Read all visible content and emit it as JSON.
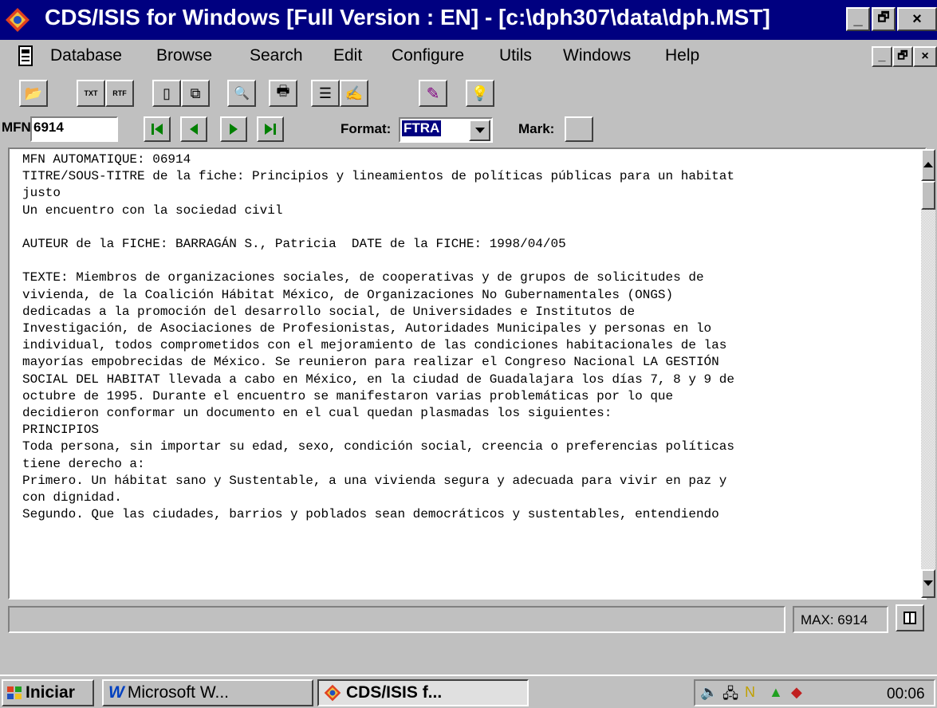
{
  "window": {
    "title": "CDS/ISIS for Windows [Full Version : EN] - [c:\\dph307\\data\\dph.MST]",
    "controls": [
      "_",
      "🗗",
      "×"
    ]
  },
  "menu": {
    "items": [
      {
        "label": "Database"
      },
      {
        "label": "Browse"
      },
      {
        "label": "Search"
      },
      {
        "label": "Edit"
      },
      {
        "label": "Configure"
      },
      {
        "label": "Utils"
      },
      {
        "label": "Windows"
      },
      {
        "label": "Help"
      }
    ],
    "controls": [
      "_",
      "🗗",
      "×"
    ]
  },
  "toolbar": {
    "buttons": [
      {
        "icon": "open-folder-icon",
        "glyph": "📂"
      },
      {
        "icon": "export-txt-icon",
        "glyph": "TXT"
      },
      {
        "icon": "export-rtf-icon",
        "glyph": "RTF"
      },
      {
        "icon": "new-record-icon",
        "glyph": "▯"
      },
      {
        "icon": "copy-record-icon",
        "glyph": "⧉"
      },
      {
        "icon": "print-preview-icon",
        "glyph": "🔍"
      },
      {
        "icon": "print-icon",
        "glyph": "🖶"
      },
      {
        "icon": "form-icon",
        "glyph": "☰"
      },
      {
        "icon": "edit-form-icon",
        "glyph": "✍"
      },
      {
        "icon": "pencil-icon",
        "glyph": "✎"
      },
      {
        "icon": "lightbulb-icon",
        "glyph": "💡"
      }
    ]
  },
  "navbar": {
    "mfn_label": "MFN",
    "mfn_value": "6914",
    "format_label": "Format:",
    "format_value": "FTRA",
    "mark_label": "Mark:"
  },
  "record": {
    "lines": [
      "MFN AUTOMATIQUE: 06914",
      "TITRE/SOUS-TITRE de la fiche: Principios y lineamientos de políticas públicas para un habitat",
      "justo",
      "Un encuentro con la sociedad civil",
      "",
      "AUTEUR de la FICHE: BARRAGÁN S., Patricia  DATE de la FICHE: 1998/04/05",
      "",
      "TEXTE: Miembros de organizaciones sociales, de cooperativas y de grupos de solicitudes de",
      "vivienda, de la Coalición Hábitat México, de Organizaciones No Gubernamentales (ONGS)",
      "dedicadas a la promoción del desarrollo social, de Universidades e Institutos de",
      "Investigación, de Asociaciones de Profesionistas, Autoridades Municipales y personas en lo",
      "individual, todos comprometidos con el mejoramiento de las condiciones habitacionales de las",
      "mayorías empobrecidas de México. Se reunieron para realizar el Congreso Nacional LA GESTIÓN",
      "SOCIAL DEL HABITAT llevada a cabo en México, en la ciudad de Guadalajara los días 7, 8 y 9 de",
      "octubre de 1995. Durante el encuentro se manifestaron varias problemáticas por lo que",
      "decidieron conformar un documento en el cual quedan plasmadas los siguientes:",
      "PRINCIPIOS",
      "Toda persona, sin importar su edad, sexo, condición social, creencia o preferencias políticas",
      "tiene derecho a:",
      "Primero. Un hábitat sano y Sustentable, a una vivienda segura y adecuada para vivir en paz y",
      "con dignidad.",
      "Segundo. Que las ciudades, barrios y poblados sean democráticos y sustentables, entendiendo"
    ]
  },
  "status": {
    "max_label": "MAX: 6914"
  },
  "taskbar": {
    "start_label": "Iniciar",
    "tasks": [
      {
        "label": "Microsoft W..."
      },
      {
        "label": "CDS/ISIS f..."
      }
    ],
    "clock": "00:06"
  }
}
